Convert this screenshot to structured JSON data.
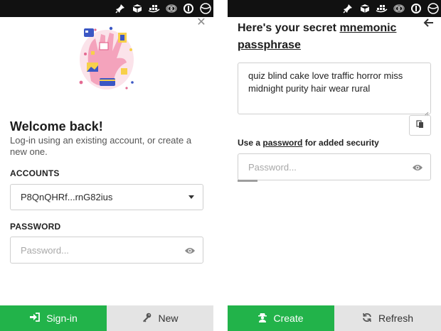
{
  "left": {
    "title": "Welcome back!",
    "subtitle": "Log-in using an existing account, or create a new one.",
    "accounts_label": "ACCOUNTS",
    "selected_account": "P8QnQHRf...rnG82ius",
    "password_label": "PASSWORD",
    "password_placeholder": "Password...",
    "signin_label": "Sign-in",
    "new_label": "New",
    "close_glyph": "✕"
  },
  "right": {
    "title_pre": "Here's your secret ",
    "title_link1": "mnemonic",
    "title_link2": "passphrase",
    "mnemonic": "quiz blind cake love traffic horror miss midnight purity hair wear rural",
    "security_pre": "Use a ",
    "security_link": "password",
    "security_post": " for added security",
    "password_placeholder": "Password...",
    "create_label": "Create",
    "refresh_label": "Refresh"
  },
  "topbar_icons": [
    "pin-icon",
    "cube-icon",
    "docker-icon",
    "cloud-icon",
    "onepassword-icon",
    "globe-icon"
  ],
  "colors": {
    "accent_green": "#22b34a",
    "secondary_grey": "#e4e4e4",
    "topbar": "#111111"
  }
}
